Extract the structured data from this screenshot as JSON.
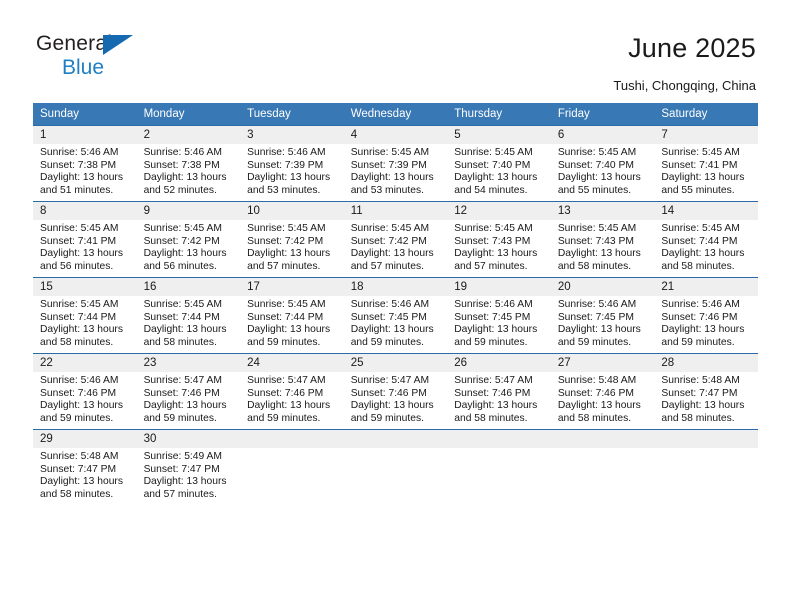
{
  "brand": {
    "line1": "General",
    "line2": "Blue",
    "accent_color": "#1f7fc4",
    "triangle_color": "#1569b0"
  },
  "header": {
    "title": "June 2025",
    "subtitle": "Tushi, Chongqing, China"
  },
  "calendar": {
    "header_bg": "#3878b4",
    "daynum_bg": "#efefef",
    "weekday_headers": [
      "Sunday",
      "Monday",
      "Tuesday",
      "Wednesday",
      "Thursday",
      "Friday",
      "Saturday"
    ],
    "weeks": [
      [
        {
          "day": "1",
          "sunrise": "Sunrise: 5:46 AM",
          "sunset": "Sunset: 7:38 PM",
          "daylight1": "Daylight: 13 hours",
          "daylight2": "and 51 minutes."
        },
        {
          "day": "2",
          "sunrise": "Sunrise: 5:46 AM",
          "sunset": "Sunset: 7:38 PM",
          "daylight1": "Daylight: 13 hours",
          "daylight2": "and 52 minutes."
        },
        {
          "day": "3",
          "sunrise": "Sunrise: 5:46 AM",
          "sunset": "Sunset: 7:39 PM",
          "daylight1": "Daylight: 13 hours",
          "daylight2": "and 53 minutes."
        },
        {
          "day": "4",
          "sunrise": "Sunrise: 5:45 AM",
          "sunset": "Sunset: 7:39 PM",
          "daylight1": "Daylight: 13 hours",
          "daylight2": "and 53 minutes."
        },
        {
          "day": "5",
          "sunrise": "Sunrise: 5:45 AM",
          "sunset": "Sunset: 7:40 PM",
          "daylight1": "Daylight: 13 hours",
          "daylight2": "and 54 minutes."
        },
        {
          "day": "6",
          "sunrise": "Sunrise: 5:45 AM",
          "sunset": "Sunset: 7:40 PM",
          "daylight1": "Daylight: 13 hours",
          "daylight2": "and 55 minutes."
        },
        {
          "day": "7",
          "sunrise": "Sunrise: 5:45 AM",
          "sunset": "Sunset: 7:41 PM",
          "daylight1": "Daylight: 13 hours",
          "daylight2": "and 55 minutes."
        }
      ],
      [
        {
          "day": "8",
          "sunrise": "Sunrise: 5:45 AM",
          "sunset": "Sunset: 7:41 PM",
          "daylight1": "Daylight: 13 hours",
          "daylight2": "and 56 minutes."
        },
        {
          "day": "9",
          "sunrise": "Sunrise: 5:45 AM",
          "sunset": "Sunset: 7:42 PM",
          "daylight1": "Daylight: 13 hours",
          "daylight2": "and 56 minutes."
        },
        {
          "day": "10",
          "sunrise": "Sunrise: 5:45 AM",
          "sunset": "Sunset: 7:42 PM",
          "daylight1": "Daylight: 13 hours",
          "daylight2": "and 57 minutes."
        },
        {
          "day": "11",
          "sunrise": "Sunrise: 5:45 AM",
          "sunset": "Sunset: 7:42 PM",
          "daylight1": "Daylight: 13 hours",
          "daylight2": "and 57 minutes."
        },
        {
          "day": "12",
          "sunrise": "Sunrise: 5:45 AM",
          "sunset": "Sunset: 7:43 PM",
          "daylight1": "Daylight: 13 hours",
          "daylight2": "and 57 minutes."
        },
        {
          "day": "13",
          "sunrise": "Sunrise: 5:45 AM",
          "sunset": "Sunset: 7:43 PM",
          "daylight1": "Daylight: 13 hours",
          "daylight2": "and 58 minutes."
        },
        {
          "day": "14",
          "sunrise": "Sunrise: 5:45 AM",
          "sunset": "Sunset: 7:44 PM",
          "daylight1": "Daylight: 13 hours",
          "daylight2": "and 58 minutes."
        }
      ],
      [
        {
          "day": "15",
          "sunrise": "Sunrise: 5:45 AM",
          "sunset": "Sunset: 7:44 PM",
          "daylight1": "Daylight: 13 hours",
          "daylight2": "and 58 minutes."
        },
        {
          "day": "16",
          "sunrise": "Sunrise: 5:45 AM",
          "sunset": "Sunset: 7:44 PM",
          "daylight1": "Daylight: 13 hours",
          "daylight2": "and 58 minutes."
        },
        {
          "day": "17",
          "sunrise": "Sunrise: 5:45 AM",
          "sunset": "Sunset: 7:44 PM",
          "daylight1": "Daylight: 13 hours",
          "daylight2": "and 59 minutes."
        },
        {
          "day": "18",
          "sunrise": "Sunrise: 5:46 AM",
          "sunset": "Sunset: 7:45 PM",
          "daylight1": "Daylight: 13 hours",
          "daylight2": "and 59 minutes."
        },
        {
          "day": "19",
          "sunrise": "Sunrise: 5:46 AM",
          "sunset": "Sunset: 7:45 PM",
          "daylight1": "Daylight: 13 hours",
          "daylight2": "and 59 minutes."
        },
        {
          "day": "20",
          "sunrise": "Sunrise: 5:46 AM",
          "sunset": "Sunset: 7:45 PM",
          "daylight1": "Daylight: 13 hours",
          "daylight2": "and 59 minutes."
        },
        {
          "day": "21",
          "sunrise": "Sunrise: 5:46 AM",
          "sunset": "Sunset: 7:46 PM",
          "daylight1": "Daylight: 13 hours",
          "daylight2": "and 59 minutes."
        }
      ],
      [
        {
          "day": "22",
          "sunrise": "Sunrise: 5:46 AM",
          "sunset": "Sunset: 7:46 PM",
          "daylight1": "Daylight: 13 hours",
          "daylight2": "and 59 minutes."
        },
        {
          "day": "23",
          "sunrise": "Sunrise: 5:47 AM",
          "sunset": "Sunset: 7:46 PM",
          "daylight1": "Daylight: 13 hours",
          "daylight2": "and 59 minutes."
        },
        {
          "day": "24",
          "sunrise": "Sunrise: 5:47 AM",
          "sunset": "Sunset: 7:46 PM",
          "daylight1": "Daylight: 13 hours",
          "daylight2": "and 59 minutes."
        },
        {
          "day": "25",
          "sunrise": "Sunrise: 5:47 AM",
          "sunset": "Sunset: 7:46 PM",
          "daylight1": "Daylight: 13 hours",
          "daylight2": "and 59 minutes."
        },
        {
          "day": "26",
          "sunrise": "Sunrise: 5:47 AM",
          "sunset": "Sunset: 7:46 PM",
          "daylight1": "Daylight: 13 hours",
          "daylight2": "and 58 minutes."
        },
        {
          "day": "27",
          "sunrise": "Sunrise: 5:48 AM",
          "sunset": "Sunset: 7:46 PM",
          "daylight1": "Daylight: 13 hours",
          "daylight2": "and 58 minutes."
        },
        {
          "day": "28",
          "sunrise": "Sunrise: 5:48 AM",
          "sunset": "Sunset: 7:47 PM",
          "daylight1": "Daylight: 13 hours",
          "daylight2": "and 58 minutes."
        }
      ],
      [
        {
          "day": "29",
          "sunrise": "Sunrise: 5:48 AM",
          "sunset": "Sunset: 7:47 PM",
          "daylight1": "Daylight: 13 hours",
          "daylight2": "and 58 minutes."
        },
        {
          "day": "30",
          "sunrise": "Sunrise: 5:49 AM",
          "sunset": "Sunset: 7:47 PM",
          "daylight1": "Daylight: 13 hours",
          "daylight2": "and 57 minutes."
        },
        {
          "day": "",
          "sunrise": "",
          "sunset": "",
          "daylight1": "",
          "daylight2": ""
        },
        {
          "day": "",
          "sunrise": "",
          "sunset": "",
          "daylight1": "",
          "daylight2": ""
        },
        {
          "day": "",
          "sunrise": "",
          "sunset": "",
          "daylight1": "",
          "daylight2": ""
        },
        {
          "day": "",
          "sunrise": "",
          "sunset": "",
          "daylight1": "",
          "daylight2": ""
        },
        {
          "day": "",
          "sunrise": "",
          "sunset": "",
          "daylight1": "",
          "daylight2": ""
        }
      ]
    ]
  }
}
